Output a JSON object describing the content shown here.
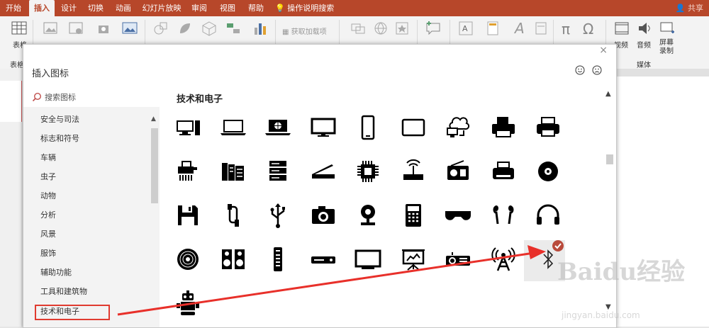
{
  "ribbon": {
    "tabs": [
      {
        "label": "开始",
        "active": false
      },
      {
        "label": "插入",
        "active": true
      },
      {
        "label": "设计",
        "active": false
      },
      {
        "label": "切换",
        "active": false
      },
      {
        "label": "动画",
        "active": false
      },
      {
        "label": "幻灯片放映",
        "active": false
      },
      {
        "label": "审阅",
        "active": false
      },
      {
        "label": "视图",
        "active": false
      },
      {
        "label": "帮助",
        "active": false
      }
    ],
    "tell_me": "操作说明搜索",
    "share": "共享",
    "table_label": "表格",
    "addins_label": "获取加载项",
    "video_label": "视频",
    "audio_label": "音频",
    "record_label": "屏幕录制",
    "group_media": "媒体",
    "group_table": "表格",
    "accent_color": "#b7472a"
  },
  "dialog": {
    "title": "插入图标",
    "close": "×",
    "search_placeholder": "搜索图标",
    "section_title": "技术和电子",
    "categories": [
      "安全与司法",
      "标志和符号",
      "车辆",
      "虫子",
      "动物",
      "分析",
      "风景",
      "服饰",
      "辅助功能",
      "工具和建筑物",
      "技术和电子"
    ],
    "selected_category": "技术和电子",
    "icons": [
      "desktop-computer-icon",
      "laptop-icon",
      "laptop-globe-icon",
      "monitor-icon",
      "smartphone-icon",
      "tablet-icon",
      "cloud-sync-icon",
      "printer-icon",
      "fax-printer-icon",
      "shredder-icon",
      "server-rack-icon",
      "server-icon",
      "flatbed-scanner-icon",
      "cpu-chip-icon",
      "router-icon",
      "radio-icon",
      "typewriter-icon",
      "disc-icon",
      "floppy-disk-icon",
      "usb-cable-icon",
      "usb-symbol-icon",
      "camera-icon",
      "webcam-icon",
      "calculator-icon",
      "vr-headset-icon",
      "earbuds-icon",
      "headphones-icon",
      "vinyl-record-icon",
      "speakers-icon",
      "remote-control-icon",
      "dvd-player-icon",
      "flat-tv-icon",
      "projector-screen-icon",
      "projector-icon",
      "radio-tower-icon",
      "bluetooth-icon",
      "robot-icon"
    ],
    "selected_icon": "bluetooth-icon"
  },
  "watermark": {
    "brand": "Baidu经验",
    "url": "jingyan.baidu.com"
  }
}
